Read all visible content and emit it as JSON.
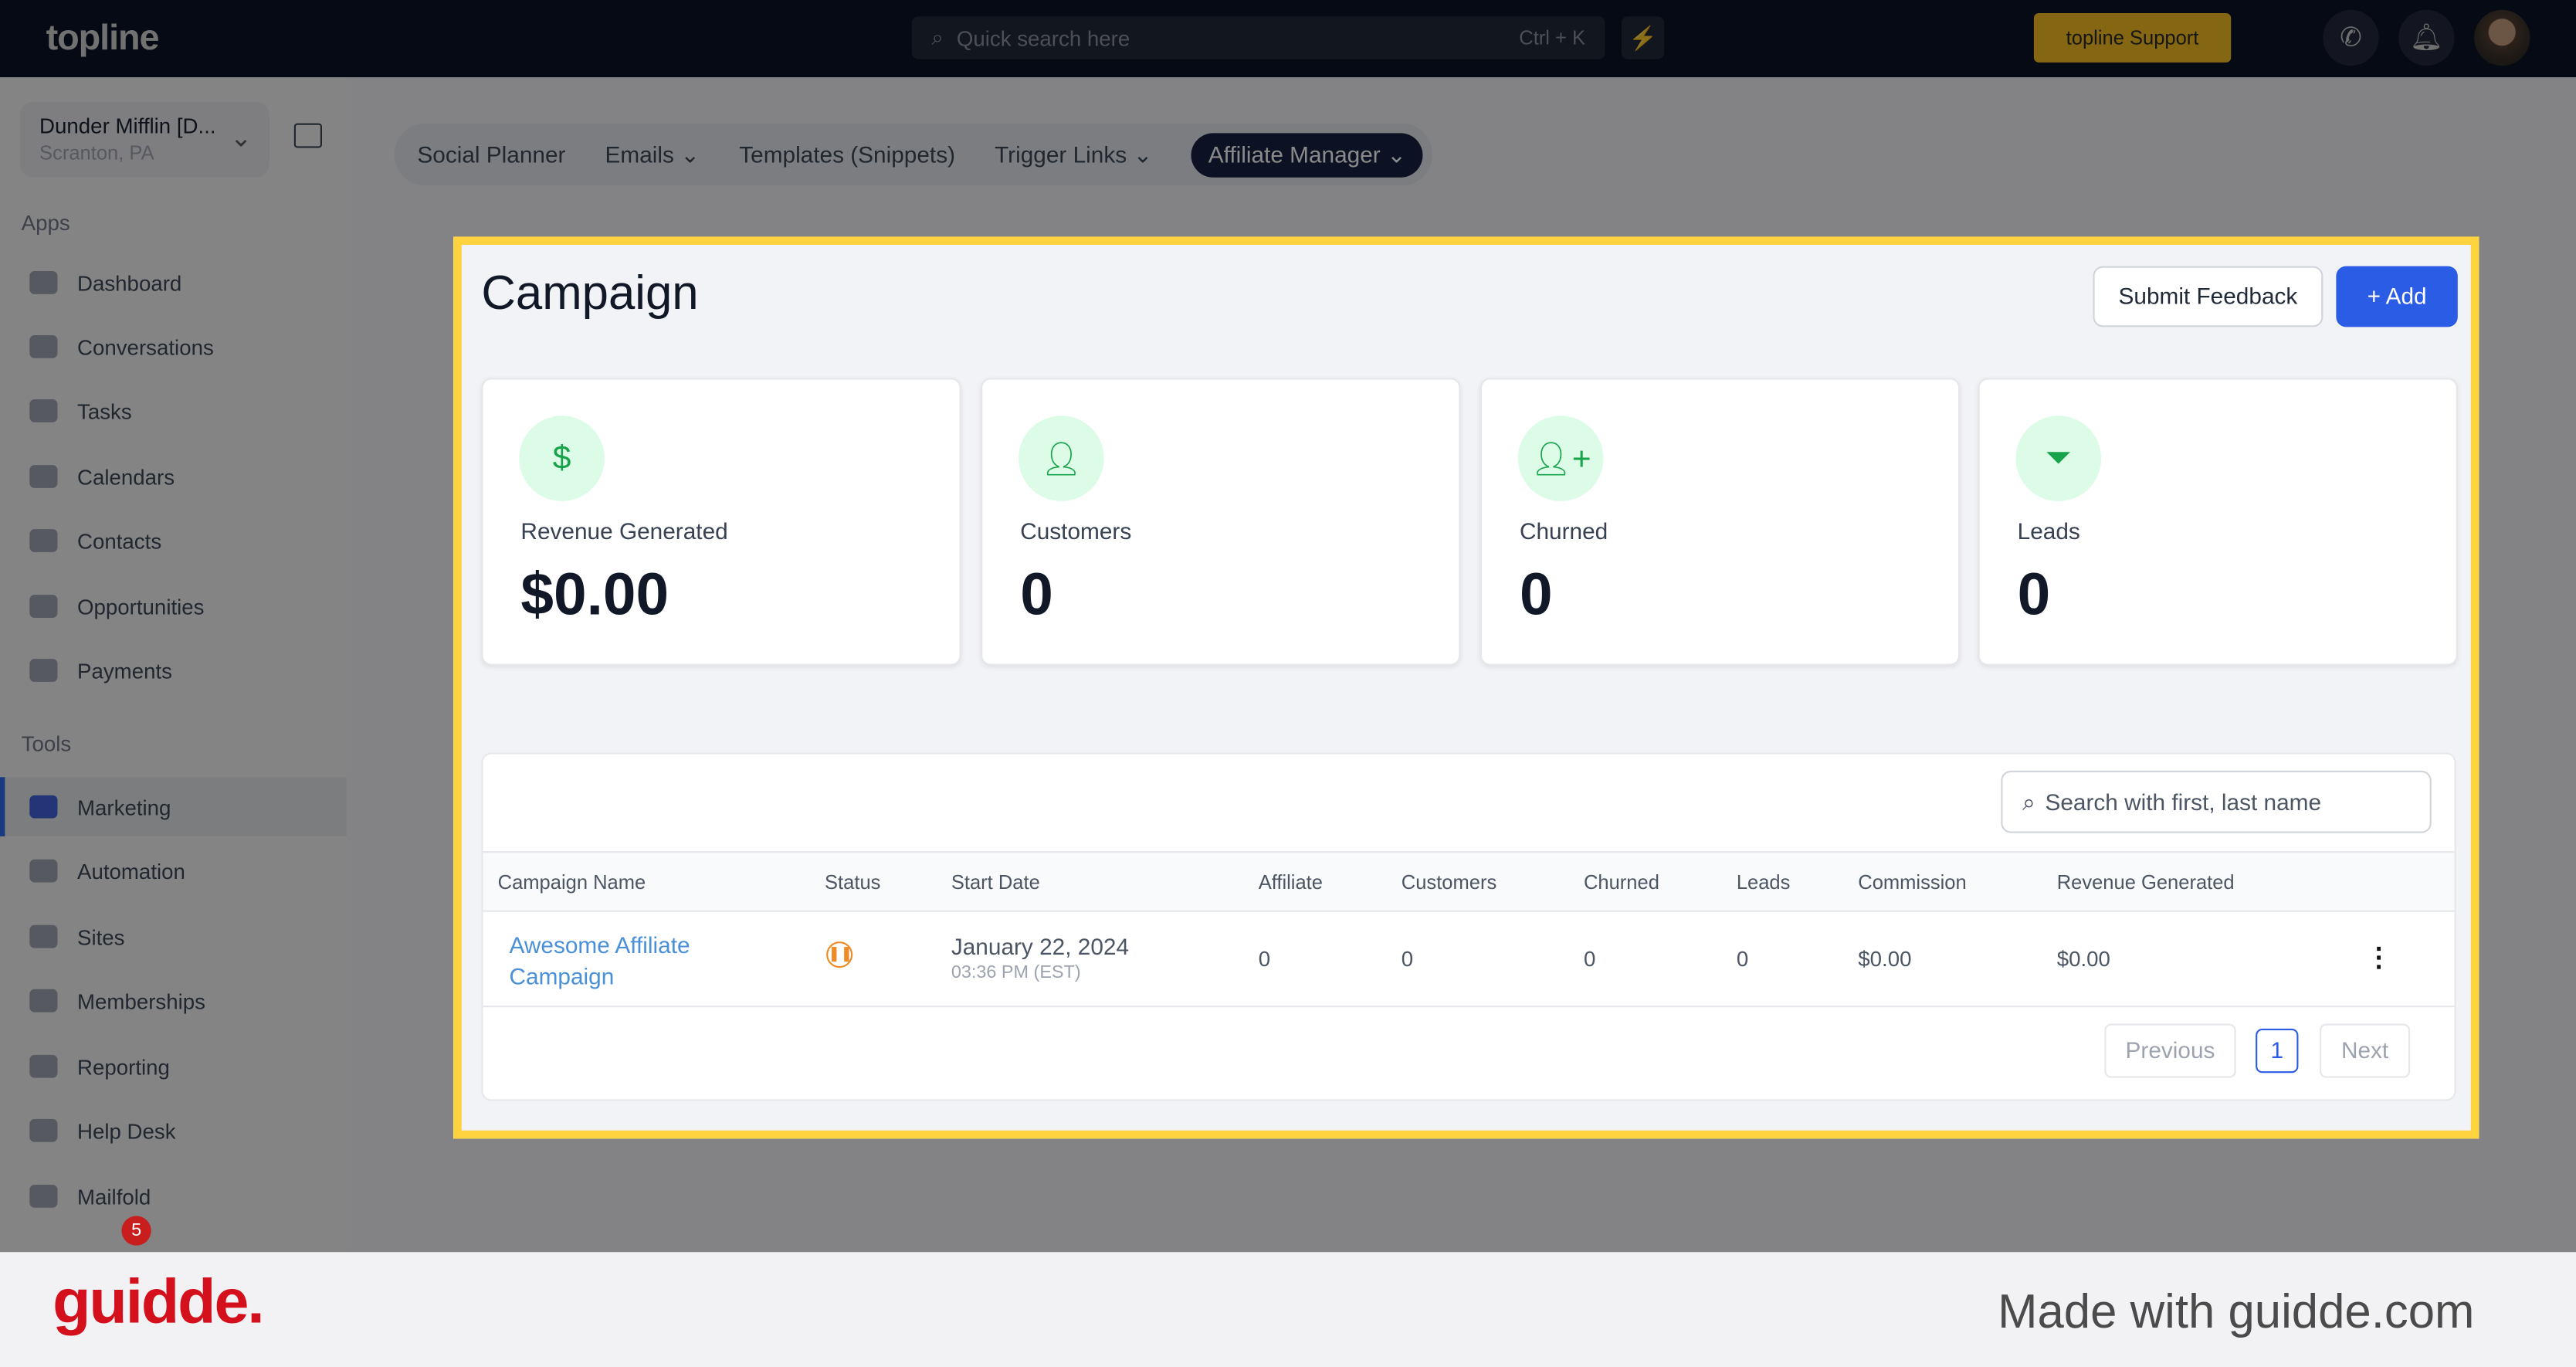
{
  "topbar": {
    "logo": "topline",
    "search_placeholder": "Quick search here",
    "search_shortcut": "Ctrl + K",
    "support": "topline Support"
  },
  "account": {
    "name": "Dunder Mifflin [D...",
    "location": "Scranton, PA"
  },
  "sidebar": {
    "apps_label": "Apps",
    "tools_label": "Tools",
    "apps": [
      "Dashboard",
      "Conversations",
      "Tasks",
      "Calendars",
      "Contacts",
      "Opportunities",
      "Payments"
    ],
    "tools": [
      "Marketing",
      "Automation",
      "Sites",
      "Memberships",
      "Reporting",
      "Help Desk",
      "Mailfold"
    ],
    "active": "Marketing",
    "badge_count": "5"
  },
  "tabs": [
    {
      "label": "Social Planner"
    },
    {
      "label": "Emails ⌄"
    },
    {
      "label": "Templates (Snippets)"
    },
    {
      "label": "Trigger Links ⌄"
    },
    {
      "label": "Affiliate Manager ⌄",
      "active": true
    }
  ],
  "page": {
    "title": "Campaign",
    "feedback": "Submit Feedback",
    "add": "+ Add"
  },
  "stats": [
    {
      "label": "Revenue Generated",
      "value": "$0.00",
      "icon": "dollar-icon"
    },
    {
      "label": "Customers",
      "value": "0",
      "icon": "user-icon"
    },
    {
      "label": "Churned",
      "value": "0",
      "icon": "user-plus-icon"
    },
    {
      "label": "Leads",
      "value": "0",
      "icon": "funnel-icon"
    }
  ],
  "table": {
    "search_placeholder": "Search with first, last name",
    "columns": [
      "Campaign Name",
      "Status",
      "Start Date",
      "Affiliate",
      "Customers",
      "Churned",
      "Leads",
      "Commission",
      "Revenue Generated"
    ],
    "rows": [
      {
        "name_line1": "Awesome Affiliate",
        "name_line2": "Campaign",
        "status": "paused",
        "date": "January 22, 2024",
        "time": "03:36 PM (EST)",
        "affiliate": "0",
        "customers": "0",
        "churned": "0",
        "leads": "0",
        "commission": "$0.00",
        "revenue": "$0.00"
      }
    ],
    "pagination": {
      "previous": "Previous",
      "page": "1",
      "next": "Next"
    }
  },
  "colors": {
    "accent": "#2b5ce6",
    "highlight": "#ffd340",
    "link": "#4a90d9",
    "status_paused": "#f08a24"
  },
  "footer": {
    "brand": "guidde.",
    "made_with": "Made with guidde.com"
  }
}
